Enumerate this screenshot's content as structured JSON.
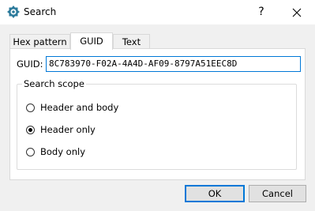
{
  "window": {
    "title": "Search",
    "help_glyph": "?"
  },
  "tabs": [
    {
      "label": "Hex pattern",
      "active": false
    },
    {
      "label": "GUID",
      "active": true
    },
    {
      "label": "Text",
      "active": false
    }
  ],
  "guid": {
    "label": "GUID:",
    "value": "8C783970-F02A-4A4D-AF09-8797A51EEC8D"
  },
  "scope": {
    "legend": "Search scope",
    "options": [
      {
        "label": "Header and body",
        "checked": false
      },
      {
        "label": "Header only",
        "checked": true
      },
      {
        "label": "Body only",
        "checked": false
      }
    ]
  },
  "buttons": {
    "ok": "OK",
    "cancel": "Cancel"
  },
  "colors": {
    "accent": "#0078d7",
    "icon": "#2b7a9b"
  }
}
